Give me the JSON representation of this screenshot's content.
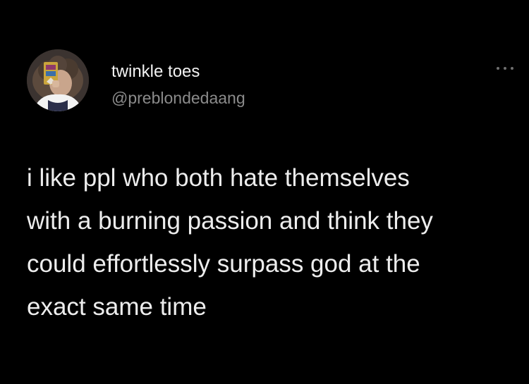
{
  "author": {
    "display_name": "twinkle toes",
    "handle": "@preblondedaang"
  },
  "tweet": {
    "lines": [
      "i like ppl who both hate themselves",
      "with a burning passion and think they",
      "could effortlessly surpass god at the",
      "exact same time"
    ]
  },
  "icons": {
    "more": "more-options-icon",
    "avatar": "profile-avatar"
  },
  "colors": {
    "background": "#000000",
    "name": "#f2f2f2",
    "handle": "#8b8b8b",
    "body": "#ededed"
  }
}
